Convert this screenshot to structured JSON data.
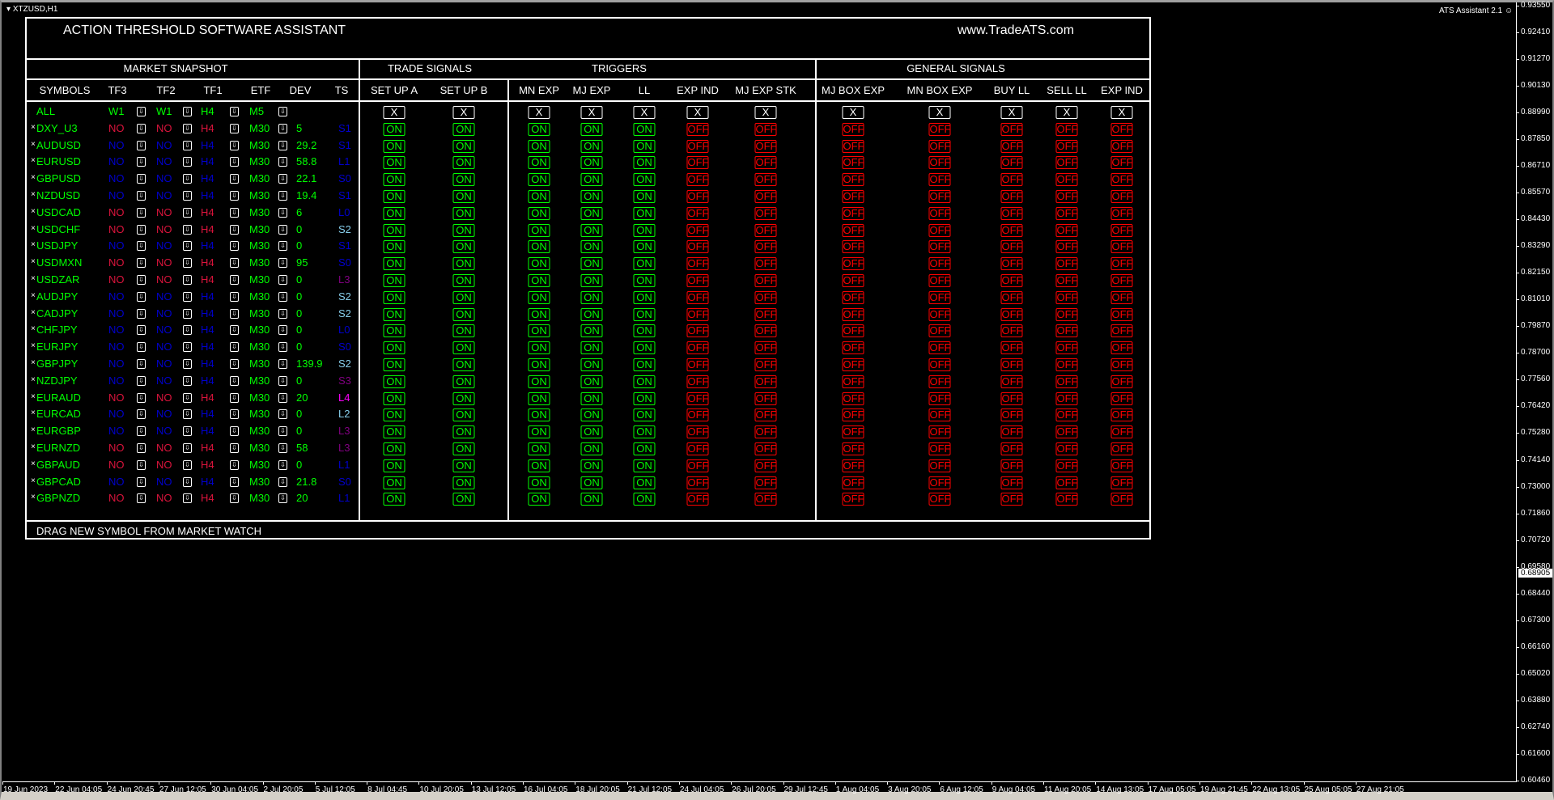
{
  "window": {
    "title": "XTZUSD,H1",
    "ea_label": "ATS Assistant 2.1",
    "ea_icon": "smiley-icon",
    "current_price": "0.68905"
  },
  "price_axis": [
    "0.93550",
    "0.92410",
    "0.91270",
    "0.90130",
    "0.88990",
    "0.87850",
    "0.86710",
    "0.85570",
    "0.84430",
    "0.83290",
    "0.82150",
    "0.81010",
    "0.79870",
    "0.78700",
    "0.77560",
    "0.76420",
    "0.75280",
    "0.74140",
    "0.73000",
    "0.71860",
    "0.70720",
    "0.69580",
    "0.68440",
    "0.67300",
    "0.66160",
    "0.65020",
    "0.63880",
    "0.62740",
    "0.61600",
    "0.60460"
  ],
  "time_axis": [
    "19 Jun 2023",
    "22 Jun 04:05",
    "24 Jun 20:45",
    "27 Jun 12:05",
    "30 Jun 04:05",
    "2 Jul 20:05",
    "5 Jul 12:05",
    "8 Jul 04:45",
    "10 Jul 20:05",
    "13 Jul 12:05",
    "16 Jul 04:05",
    "18 Jul 20:05",
    "21 Jul 12:05",
    "24 Jul 04:05",
    "26 Jul 20:05",
    "29 Jul 12:45",
    "1 Aug 04:05",
    "3 Aug 20:05",
    "6 Aug 12:05",
    "9 Aug 04:05",
    "11 Aug 20:05",
    "14 Aug 13:05",
    "17 Aug 05:05",
    "19 Aug 21:45",
    "22 Aug 13:05",
    "25 Aug 05:05",
    "27 Aug 21:05"
  ],
  "panel": {
    "title": "ACTION THRESHOLD SOFTWARE ASSISTANT",
    "website": "www.TradeATS.com",
    "sections": {
      "market": "MARKET SNAPSHOT",
      "trade": "TRADE SIGNALS",
      "triggers": "TRIGGERS",
      "general": "GENERAL SIGNALS"
    },
    "market_headers": [
      "SYMBOLS",
      "TF3",
      "TF2",
      "TF1",
      "ETF",
      "DEV",
      "TS"
    ],
    "footer": "DRAG NEW SYMBOL FROM MARKET WATCH",
    "all_row": {
      "symbol": "ALL",
      "tf3": "W1",
      "tf2": "W1",
      "tf1": "H4",
      "etf": "M5"
    },
    "remove_glyph": "×",
    "colors": {
      "green": "#00ff00",
      "red": "#dc143c",
      "blue": "#0000cd",
      "light_blue": "#87ceeb",
      "purple": "#800080",
      "magenta": "#ff00ff",
      "off_red": "#ff0000"
    },
    "signal_columns": [
      {
        "label": "SET UP A",
        "all": "X",
        "value": "ON"
      },
      {
        "label": "SET UP B",
        "all": "X",
        "value": "ON"
      },
      {
        "label": "MN EXP",
        "all": "X",
        "value": "ON"
      },
      {
        "label": "MJ EXP",
        "all": "X",
        "value": "ON"
      },
      {
        "label": "LL",
        "all": "X",
        "value": "ON"
      },
      {
        "label": "EXP IND",
        "all": "X",
        "value": "OFF"
      },
      {
        "label": "MJ EXP STK",
        "all": "X",
        "value": "OFF"
      },
      {
        "label": "MJ BOX EXP",
        "all": "X",
        "value": "OFF"
      },
      {
        "label": "MN BOX EXP",
        "all": "X",
        "value": "OFF"
      },
      {
        "label": "BUY LL",
        "all": "X",
        "value": "OFF"
      },
      {
        "label": "SELL LL",
        "all": "X",
        "value": "OFF"
      },
      {
        "label": "EXP IND",
        "all": "X",
        "value": "OFF"
      }
    ],
    "rows": [
      {
        "symbol": "DXY_U3",
        "tf3": "NO",
        "tf2": "NO",
        "tf1": "H4",
        "etf": "M30",
        "dev": "5",
        "ts": "S1",
        "bias": "red",
        "ts_color": "blue"
      },
      {
        "symbol": "AUDUSD",
        "tf3": "NO",
        "tf2": "NO",
        "tf1": "H4",
        "etf": "M30",
        "dev": "29.2",
        "ts": "S1",
        "bias": "blue",
        "ts_color": "blue"
      },
      {
        "symbol": "EURUSD",
        "tf3": "NO",
        "tf2": "NO",
        "tf1": "H4",
        "etf": "M30",
        "dev": "58.8",
        "ts": "L1",
        "bias": "blue",
        "ts_color": "blue"
      },
      {
        "symbol": "GBPUSD",
        "tf3": "NO",
        "tf2": "NO",
        "tf1": "H4",
        "etf": "M30",
        "dev": "22.1",
        "ts": "S0",
        "bias": "blue",
        "ts_color": "blue"
      },
      {
        "symbol": "NZDUSD",
        "tf3": "NO",
        "tf2": "NO",
        "tf1": "H4",
        "etf": "M30",
        "dev": "19.4",
        "ts": "S1",
        "bias": "blue",
        "ts_color": "blue"
      },
      {
        "symbol": "USDCAD",
        "tf3": "NO",
        "tf2": "NO",
        "tf1": "H4",
        "etf": "M30",
        "dev": "6",
        "ts": "L0",
        "bias": "red",
        "ts_color": "blue"
      },
      {
        "symbol": "USDCHF",
        "tf3": "NO",
        "tf2": "NO",
        "tf1": "H4",
        "etf": "M30",
        "dev": "0",
        "ts": "S2",
        "bias": "red",
        "ts_color": "light_blue"
      },
      {
        "symbol": "USDJPY",
        "tf3": "NO",
        "tf2": "NO",
        "tf1": "H4",
        "etf": "M30",
        "dev": "0",
        "ts": "S1",
        "bias": "blue",
        "ts_color": "blue"
      },
      {
        "symbol": "USDMXN",
        "tf3": "NO",
        "tf2": "NO",
        "tf1": "H4",
        "etf": "M30",
        "dev": "95",
        "ts": "S0",
        "bias": "red",
        "ts_color": "blue"
      },
      {
        "symbol": "USDZAR",
        "tf3": "NO",
        "tf2": "NO",
        "tf1": "H4",
        "etf": "M30",
        "dev": "0",
        "ts": "L3",
        "bias": "red",
        "ts_color": "purple"
      },
      {
        "symbol": "AUDJPY",
        "tf3": "NO",
        "tf2": "NO",
        "tf1": "H4",
        "etf": "M30",
        "dev": "0",
        "ts": "S2",
        "bias": "blue",
        "ts_color": "light_blue"
      },
      {
        "symbol": "CADJPY",
        "tf3": "NO",
        "tf2": "NO",
        "tf1": "H4",
        "etf": "M30",
        "dev": "0",
        "ts": "S2",
        "bias": "blue",
        "ts_color": "light_blue"
      },
      {
        "symbol": "CHFJPY",
        "tf3": "NO",
        "tf2": "NO",
        "tf1": "H4",
        "etf": "M30",
        "dev": "0",
        "ts": "L0",
        "bias": "blue",
        "ts_color": "blue"
      },
      {
        "symbol": "EURJPY",
        "tf3": "NO",
        "tf2": "NO",
        "tf1": "H4",
        "etf": "M30",
        "dev": "0",
        "ts": "S0",
        "bias": "blue",
        "ts_color": "blue"
      },
      {
        "symbol": "GBPJPY",
        "tf3": "NO",
        "tf2": "NO",
        "tf1": "H4",
        "etf": "M30",
        "dev": "139.9",
        "ts": "S2",
        "bias": "blue",
        "ts_color": "light_blue"
      },
      {
        "symbol": "NZDJPY",
        "tf3": "NO",
        "tf2": "NO",
        "tf1": "H4",
        "etf": "M30",
        "dev": "0",
        "ts": "S3",
        "bias": "blue",
        "ts_color": "purple"
      },
      {
        "symbol": "EURAUD",
        "tf3": "NO",
        "tf2": "NO",
        "tf1": "H4",
        "etf": "M30",
        "dev": "20",
        "ts": "L4",
        "bias": "red",
        "ts_color": "magenta"
      },
      {
        "symbol": "EURCAD",
        "tf3": "NO",
        "tf2": "NO",
        "tf1": "H4",
        "etf": "M30",
        "dev": "0",
        "ts": "L2",
        "bias": "blue",
        "ts_color": "light_blue"
      },
      {
        "symbol": "EURGBP",
        "tf3": "NO",
        "tf2": "NO",
        "tf1": "H4",
        "etf": "M30",
        "dev": "0",
        "ts": "L3",
        "bias": "blue",
        "ts_color": "purple"
      },
      {
        "symbol": "EURNZD",
        "tf3": "NO",
        "tf2": "NO",
        "tf1": "H4",
        "etf": "M30",
        "dev": "58",
        "ts": "L3",
        "bias": "red",
        "ts_color": "purple"
      },
      {
        "symbol": "GBPAUD",
        "tf3": "NO",
        "tf2": "NO",
        "tf1": "H4",
        "etf": "M30",
        "dev": "0",
        "ts": "L1",
        "bias": "red",
        "ts_color": "blue"
      },
      {
        "symbol": "GBPCAD",
        "tf3": "NO",
        "tf2": "NO",
        "tf1": "H4",
        "etf": "M30",
        "dev": "21.8",
        "ts": "S0",
        "bias": "blue",
        "ts_color": "blue"
      },
      {
        "symbol": "GBPNZD",
        "tf3": "NO",
        "tf2": "NO",
        "tf1": "H4",
        "etf": "M30",
        "dev": "20",
        "ts": "L1",
        "bias": "red",
        "ts_color": "blue"
      }
    ]
  }
}
